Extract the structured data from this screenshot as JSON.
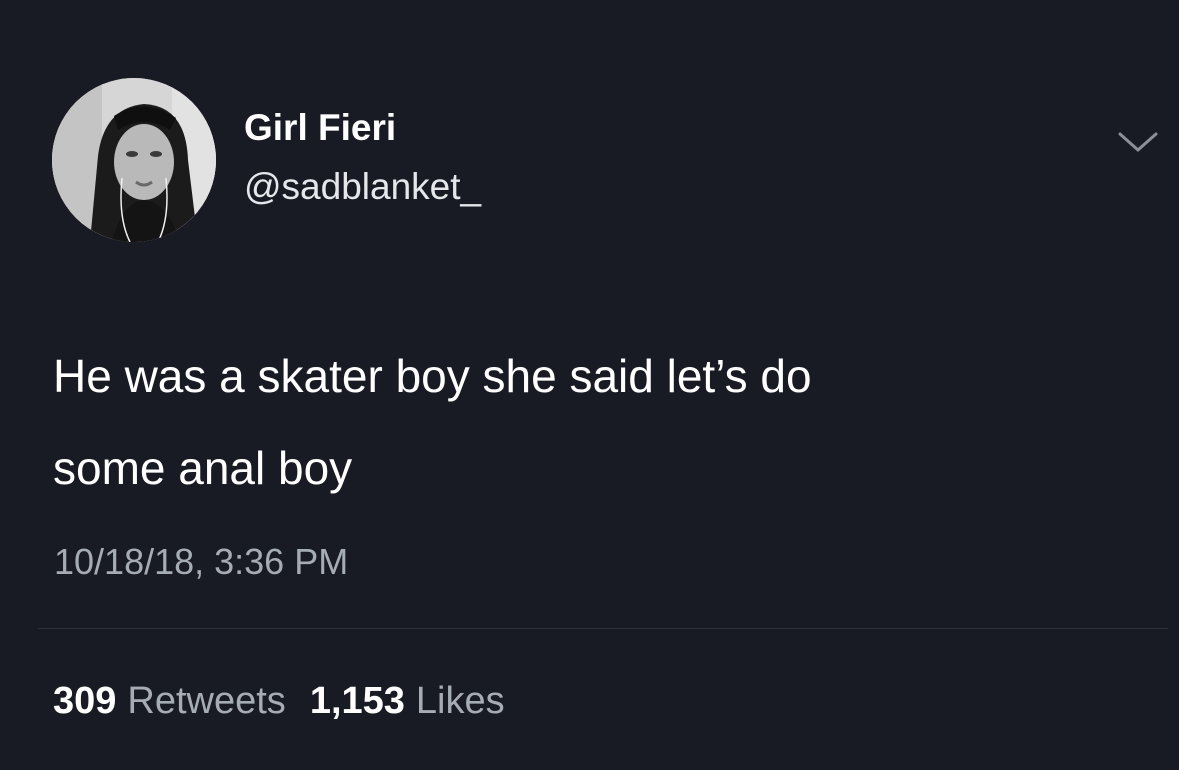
{
  "author": {
    "name": "Girl Fieri",
    "handle": "@sadblanket_",
    "avatar_icon": "profile-photo"
  },
  "tweet": {
    "lines": [
      "He was a skater boy she said let’s do",
      "some anal boy"
    ],
    "timestamp": "10/18/18, 3:36 PM"
  },
  "stats": {
    "retweets_count": "309",
    "retweets_label": "Retweets",
    "likes_count": "1,153",
    "likes_label": "Likes"
  },
  "icons": {
    "menu": "chevron-down-icon"
  },
  "colors": {
    "background": "#181b24",
    "primary_text": "#ffffff",
    "secondary_text": "#a6acb4",
    "divider": "#2b2f38"
  }
}
